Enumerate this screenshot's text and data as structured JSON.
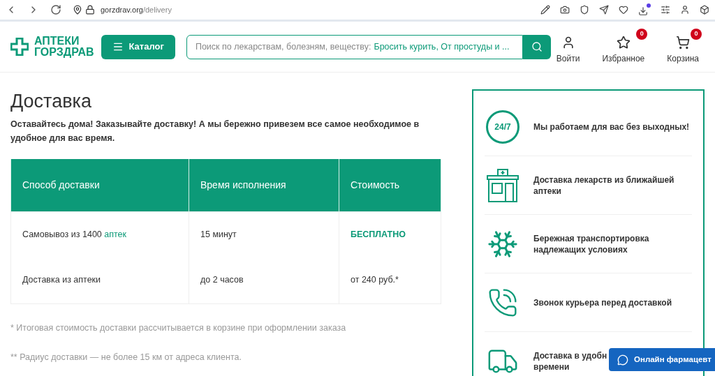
{
  "browser": {
    "host": "gorzdrav.org",
    "path": "/delivery",
    "download_badge": true
  },
  "header": {
    "logo": [
      "АПТЕКИ",
      "ГОРЗДРАВ"
    ],
    "catalog": "Каталог",
    "search": {
      "placeholder": "Поиск по лекарствам, болезням, веществу:",
      "suggestions": "Бросить курить, От простуды и ..."
    },
    "actions": [
      {
        "kind": "user",
        "label": "Войти"
      },
      {
        "kind": "star",
        "label": "Избранное",
        "badge": "0"
      },
      {
        "kind": "cart",
        "label": "Корзина",
        "badge": "0"
      }
    ]
  },
  "page": {
    "title": "Доставка",
    "lead": "Оставайтесь дома! Заказывайте доставку! А мы бережно привезем все самое необходимое в удобное для вас время.",
    "table": {
      "columns": [
        "Способ доставки",
        "Время исполнения",
        "Стоимость"
      ],
      "rows": [
        [
          {
            "text": "Самовывоз из 1400",
            "link": "аптек"
          },
          {
            "text": "15 минут"
          },
          {
            "text": "БЕСПЛАТНО",
            "highlight": true
          }
        ],
        [
          {
            "text": "Доставка из аптеки"
          },
          {
            "text": "до 2 часов"
          },
          {
            "text": "от 240 руб.*"
          }
        ]
      ]
    },
    "notes": [
      "* Итоговая стоимость доставки рассчитывается в корзине при оформлении заказа",
      "** Радиус доставки — не более 15 км от адреса клиента."
    ]
  },
  "features": [
    {
      "kind": "clock247",
      "icon_text": "24/7",
      "lines": [
        "Мы работаем для вас без выходных!"
      ]
    },
    {
      "kind": "pharmacy",
      "lines": [
        "Доставка лекарств из ближайшей",
        "аптеки"
      ]
    },
    {
      "kind": "snow",
      "lines": [
        "Бережная транспортировка",
        "надлежащих условиях"
      ]
    },
    {
      "kind": "phone",
      "lines": [
        "Звонок курьера перед доставкой"
      ]
    },
    {
      "kind": "truck",
      "lines": [
        "Доставка в удобн",
        "времени"
      ]
    }
  ],
  "chat": "Онлайн фармацевт"
}
